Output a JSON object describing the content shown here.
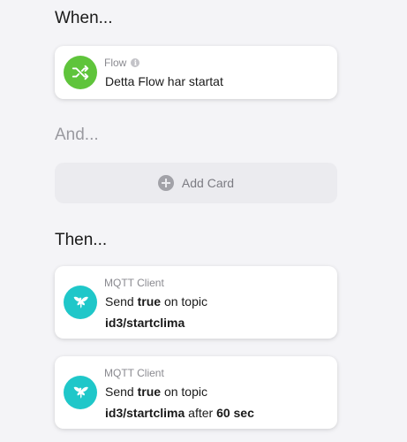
{
  "sections": {
    "when": "When...",
    "and": "And...",
    "then": "Then..."
  },
  "when_card": {
    "kind": "Flow",
    "text": "Detta Flow har startat",
    "icon": "flow-shuffle-icon",
    "color": "#5fc43b"
  },
  "add_card": {
    "label": "Add Card",
    "icon": "plus-circle-icon"
  },
  "then_cards": [
    {
      "kind": "MQTT Client",
      "icon": "mqtt-bird-icon",
      "color": "#1fc7c9",
      "send_word": "Send",
      "value": "true",
      "on_topic": "on topic",
      "topic": "id3/startclima"
    },
    {
      "kind": "MQTT Client",
      "icon": "mqtt-bird-icon",
      "color": "#1fc7c9",
      "send_word": "Send",
      "value": "true",
      "on_topic": "on topic",
      "topic": "id3/startclima",
      "after_word": "after",
      "delay": "60 sec"
    }
  ]
}
